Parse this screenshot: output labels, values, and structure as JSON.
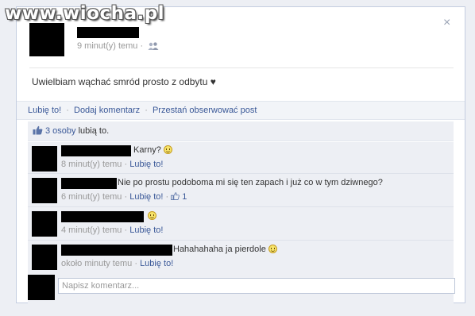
{
  "watermark": "www.wiocha.pl",
  "post": {
    "time": "9 minut(y) temu",
    "separator": "·",
    "text": "Uwielbiam wąchać smród prosto z odbytu ♥",
    "close_label": "×",
    "audience_icon": "friends-icon",
    "actions": {
      "like": "Lubię to!",
      "comment": "Dodaj komentarz",
      "unfollow": "Przestań obserwować post"
    },
    "likes": {
      "count": "3 osoby",
      "suffix": "lubią to."
    }
  },
  "comments": [
    {
      "text": "Karny?",
      "has_smiley": true,
      "time": "8 minut(y) temu",
      "like": "Lubię to!"
    },
    {
      "text": "Nie po prostu podoboma mi się ten zapach i już co w tym dziwnego?",
      "has_smiley": false,
      "time": "6 minut(y) temu",
      "like": "Lubię to!",
      "likes_count": "1"
    },
    {
      "text": "",
      "has_smiley": true,
      "time": "4 minut(y) temu",
      "like": "Lubię to!"
    },
    {
      "text": "Hahahahaha ja pierdole",
      "has_smiley": true,
      "time": "około minuty temu",
      "like": "Lubię to!"
    }
  ],
  "reply": {
    "placeholder": "Napisz komentarz..."
  },
  "colors": {
    "link": "#3b5998",
    "muted": "#999999",
    "comment_bg": "#edeff4"
  }
}
